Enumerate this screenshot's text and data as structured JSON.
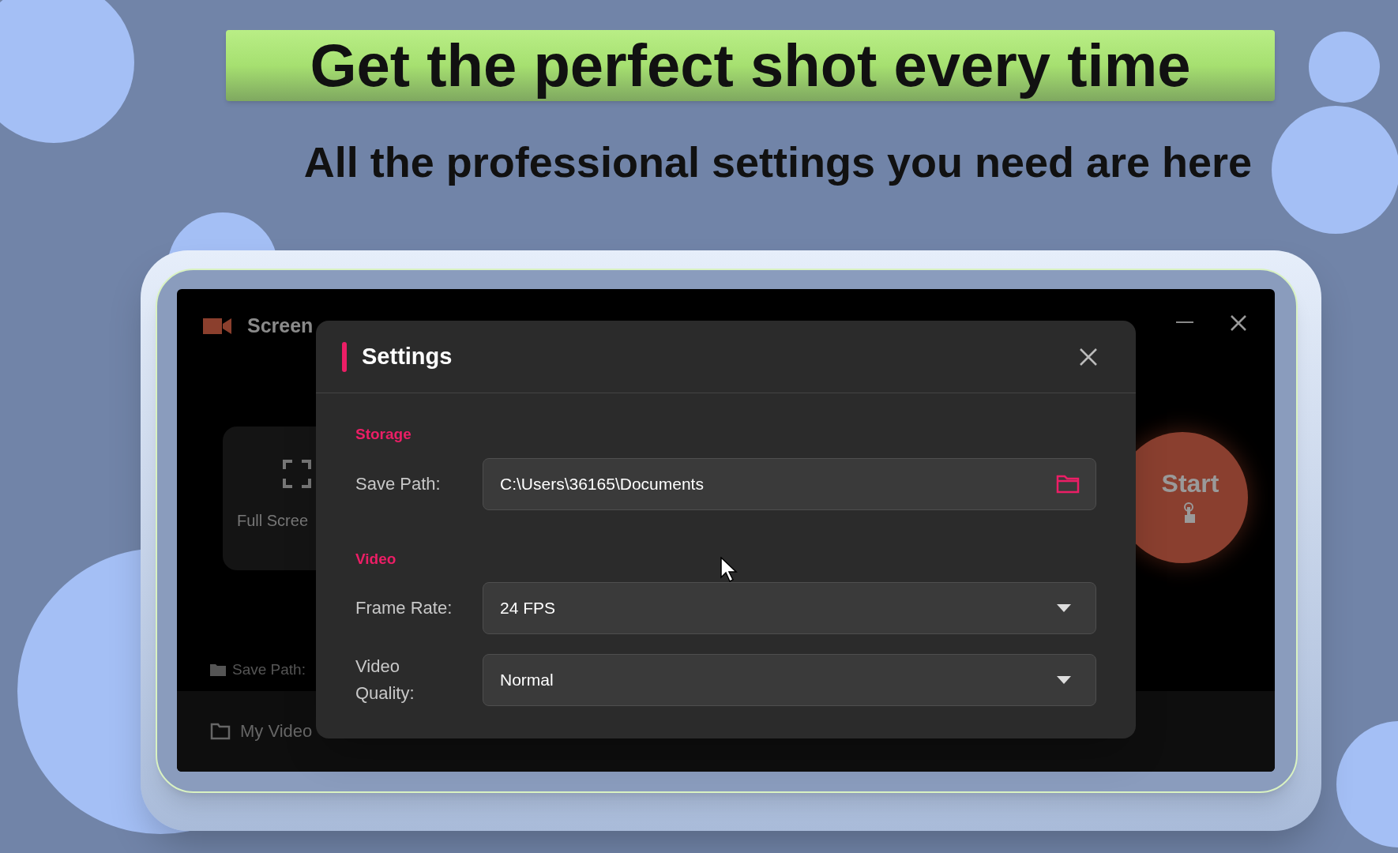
{
  "headline": "Get the perfect shot every time",
  "subheadline": "All the professional settings you need are here",
  "app": {
    "title": "Screen",
    "modes": [
      {
        "label": "Full Scree"
      }
    ],
    "save_path_label": "Save Path:",
    "start_button": "Start",
    "bottom_bar": [
      {
        "label": "My Video"
      }
    ]
  },
  "dialog": {
    "title": "Settings",
    "sections": [
      {
        "heading": "Storage",
        "fields": [
          {
            "kind": "path",
            "label": "Save Path:",
            "value": "C:\\Users\\36165\\Documents"
          }
        ]
      },
      {
        "heading": "Video",
        "fields": [
          {
            "kind": "dropdown",
            "label": "Frame Rate:",
            "value": "24 FPS"
          },
          {
            "kind": "dropdown",
            "label": "Video Quality:",
            "value": "Normal"
          }
        ]
      }
    ]
  }
}
